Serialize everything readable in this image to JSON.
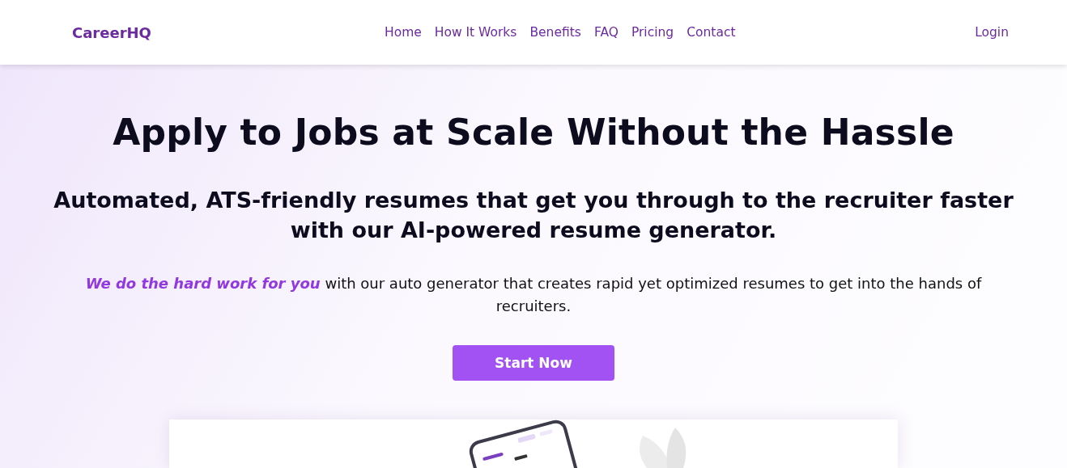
{
  "nav": {
    "logo": "CareerHQ",
    "links": [
      {
        "label": "Home"
      },
      {
        "label": "How It Works"
      },
      {
        "label": "Benefits"
      },
      {
        "label": "FAQ"
      },
      {
        "label": "Pricing"
      },
      {
        "label": "Contact"
      }
    ],
    "login": "Login"
  },
  "hero": {
    "title": "Apply to Jobs at Scale Without the Hassle",
    "subtitle": "Automated, ATS-friendly resumes that get you through to the recruiter faster with our AI-powered resume generator.",
    "description": "**We do the hard work for you** with our auto generator that creates rapid yet optimized resumes to get into the hands of recruiters.",
    "cta": "Start Now"
  }
}
